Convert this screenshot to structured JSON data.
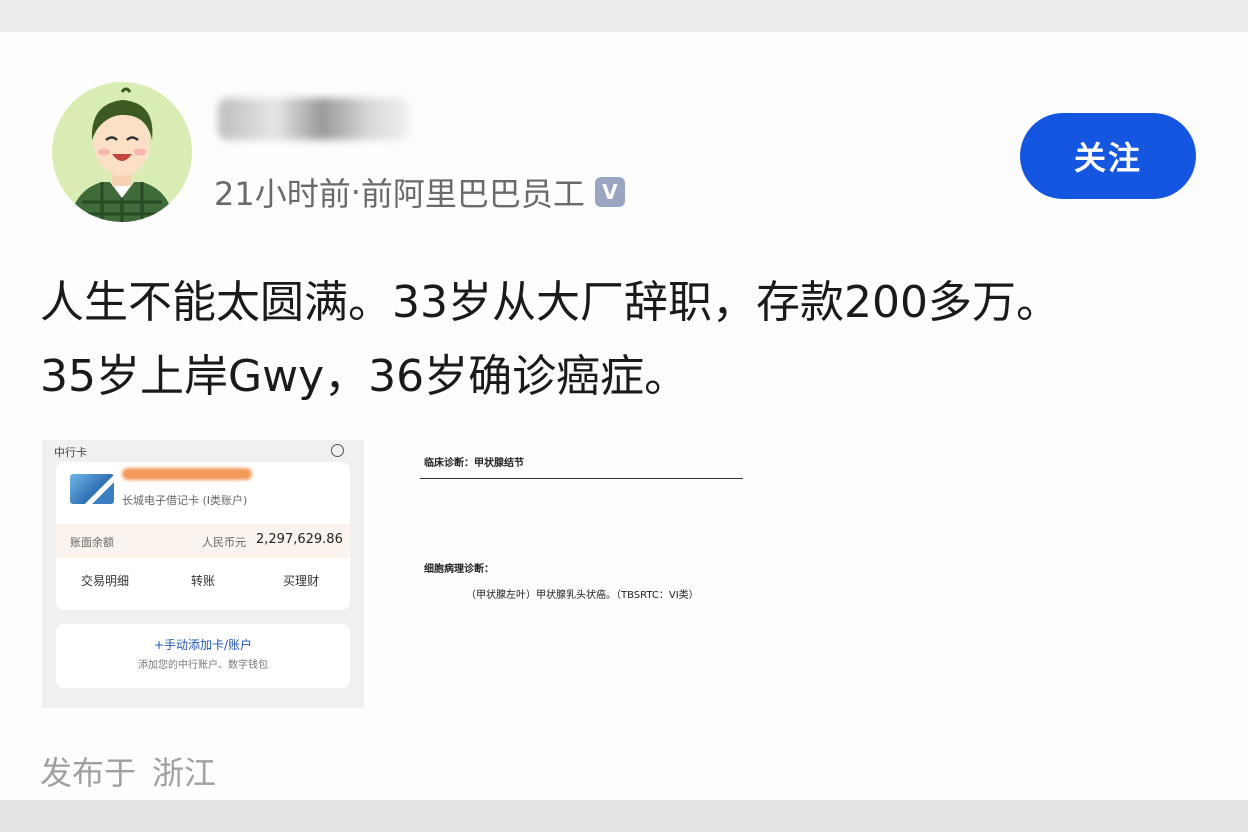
{
  "post": {
    "time": "21小时前",
    "separator": "·",
    "author_title": "前阿里巴巴员工",
    "verified_badge": "V",
    "follow_label": "关注",
    "text_line1": "人生不能太圆满。33岁从大厂辞职，存款200多万。",
    "text_line2": "35岁上岸Gwy，36岁确诊癌症。",
    "location_prefix": "发布于",
    "location": "浙江"
  },
  "bank": {
    "title": "中行卡",
    "card_name": "长城电子借记卡  (I类账户)",
    "balance_label": "账面余额",
    "currency": "人民币元",
    "amount": "2,297,629.86",
    "actions": [
      "交易明细",
      "转账",
      "买理财"
    ],
    "add_card": "+手动添加卡/账户",
    "add_desc": "添加您的中行账户、数字钱包"
  },
  "diagnosis": {
    "clinical": "临床诊断：甲状腺结节",
    "cytology_label": "细胞病理诊断：",
    "cytology_result": "（甲状腺左叶）甲状腺乳头状癌。（TBSRTC：VI类）"
  },
  "icons": {
    "avatar": "cartoon-avatar",
    "verified": "verified-icon"
  },
  "colors": {
    "follow_button": "#1556e0",
    "avatar_bg": "#d9ecb3"
  }
}
